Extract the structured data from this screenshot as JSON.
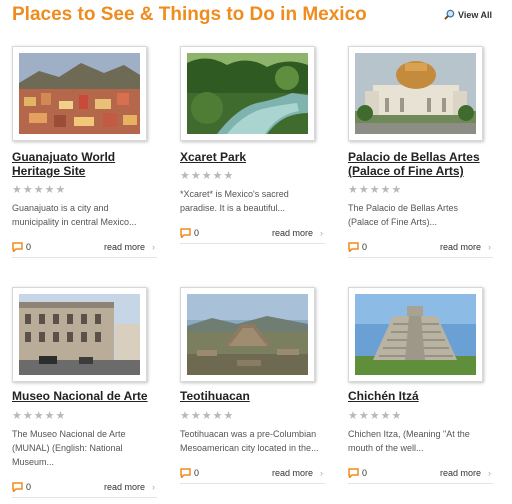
{
  "header": {
    "title": "Places to See & Things to Do in Mexico",
    "view_all_label": "View All",
    "view_all_icon": "magnifier-icon"
  },
  "colors": {
    "accent": "#f08c1e",
    "comment_icon": "#f08c1e",
    "star_empty": "#b8b8b8"
  },
  "places": [
    {
      "title": "Guanajuato World Heritage Site",
      "rating_stars": 5,
      "rating_value": 0,
      "description": "Guanajuato is a city and municipality in central Mexico...",
      "comment_count": "0",
      "read_more": "read more"
    },
    {
      "title": "Xcaret Park",
      "rating_stars": 5,
      "rating_value": 0,
      "description": "*Xcaret* is Mexico's sacred paradise. It is a beautiful...",
      "comment_count": "0",
      "read_more": "read more"
    },
    {
      "title": "Palacio de Bellas Artes (Palace of Fine Arts)",
      "rating_stars": 5,
      "rating_value": 0,
      "description": "The Palacio de Bellas Artes (Palace of Fine Arts)...",
      "comment_count": "0",
      "read_more": "read more"
    },
    {
      "title": "Museo Nacional de Arte",
      "rating_stars": 5,
      "rating_value": 0,
      "description": "The Museo Nacional de Arte (MUNAL) (English: National Museum...",
      "comment_count": "0",
      "read_more": "read more"
    },
    {
      "title": "Teotihuacan",
      "rating_stars": 5,
      "rating_value": 0,
      "description": "Teotihuacan was a pre-Columbian Mesoamerican city located in the...",
      "comment_count": "0",
      "read_more": "read more"
    },
    {
      "title": "Chichén Itzá",
      "rating_stars": 5,
      "rating_value": 0,
      "description": "Chichen Itza, (Meaning \"At the mouth of the well...",
      "comment_count": "0",
      "read_more": "read more"
    }
  ]
}
